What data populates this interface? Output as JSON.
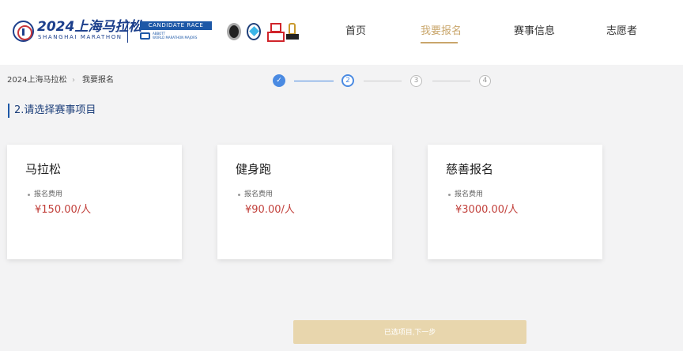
{
  "header": {
    "logo_title": "2024上海马拉松",
    "logo_sub": "SHANGHAI MARATHON",
    "badge": "CANDIDATE RACE",
    "abbott_line1": "ABBOTT",
    "abbott_line2": "WORLD MARATHON MAJORS",
    "nav": [
      {
        "label": "首页",
        "active": false
      },
      {
        "label": "我要报名",
        "active": true
      },
      {
        "label": "赛事信息",
        "active": false
      },
      {
        "label": "志愿者",
        "active": false
      }
    ],
    "accent_color": "#c9a66b"
  },
  "breadcrumb": [
    "2024上海马拉松",
    "我要报名"
  ],
  "stepper": {
    "steps": [
      "1",
      "2",
      "3",
      "4"
    ],
    "current": 2,
    "done_icon": "check-icon"
  },
  "section_title": "2.请选择赛事项目",
  "cards": [
    {
      "name": "马拉松",
      "fee_label": "报名费用",
      "price": "¥150.00/人"
    },
    {
      "name": "健身跑",
      "fee_label": "报名费用",
      "price": "¥90.00/人"
    },
    {
      "name": "慈善报名",
      "fee_label": "报名费用",
      "price": "¥3000.00/人"
    }
  ],
  "next_button": "已选项目,下一步",
  "colors": {
    "primary": "#4a8ae2",
    "price": "#c2413c",
    "button": "#e8d6ad"
  }
}
